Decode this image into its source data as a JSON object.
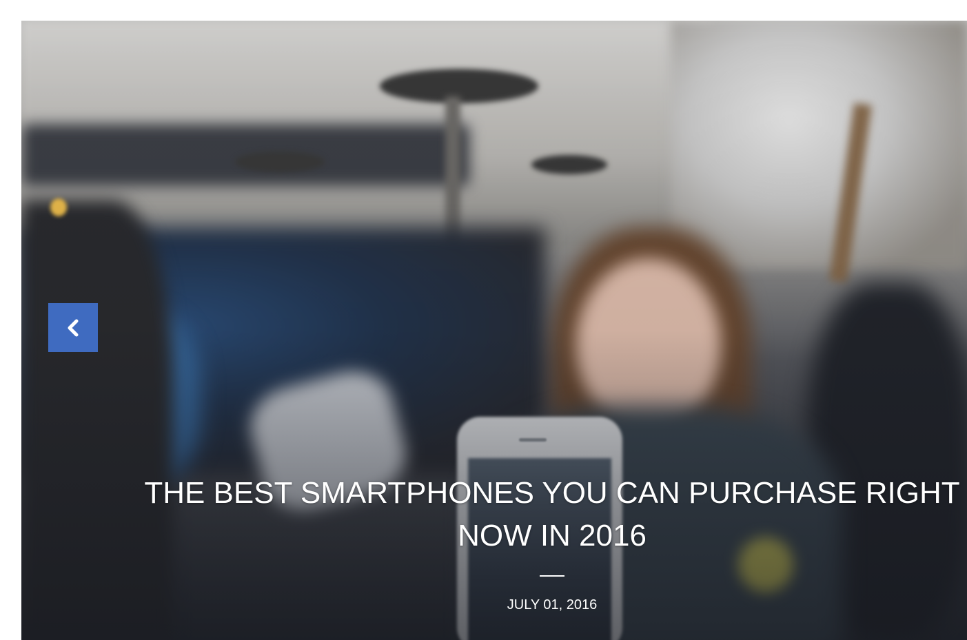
{
  "slider": {
    "image_alt": "",
    "prev_icon": "chevron-left-icon",
    "accent_color": "#3f6bc0",
    "slide": {
      "title": "THE BEST SMARTPHONES YOU CAN PURCHASE RIGHT NOW IN 2016",
      "date": "JULY 01, 2016"
    }
  }
}
